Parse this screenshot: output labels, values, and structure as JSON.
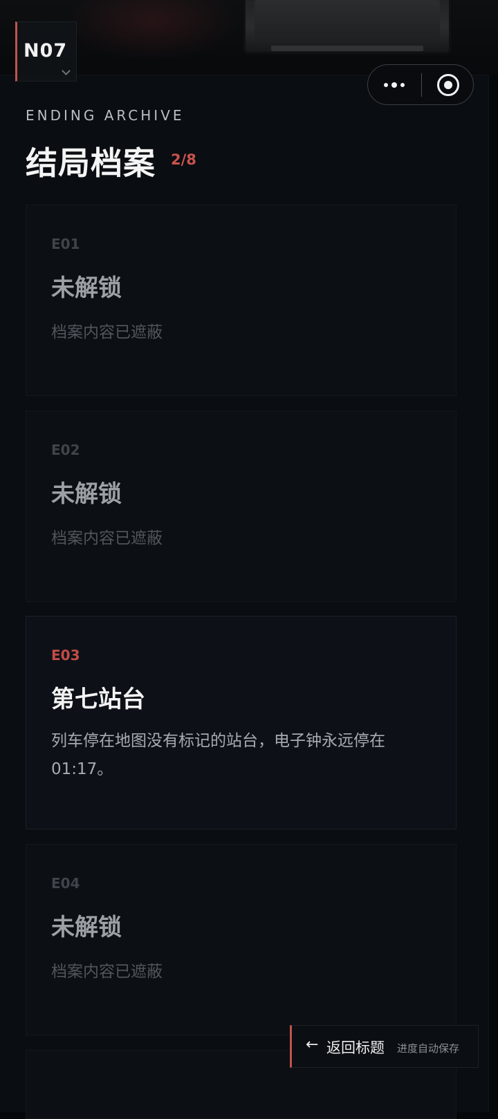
{
  "top_badge": {
    "label": "N07"
  },
  "capsule": {
    "more_icon": "more-dots-icon",
    "target_icon": "close-target-icon"
  },
  "header": {
    "subtitle": "ENDING ARCHIVE",
    "title": "结局档案",
    "count": "2/8"
  },
  "endings": [
    {
      "code": "E01",
      "name": "未解锁",
      "desc": "档案内容已遮蔽",
      "unlocked": false
    },
    {
      "code": "E02",
      "name": "未解锁",
      "desc": "档案内容已遮蔽",
      "unlocked": false
    },
    {
      "code": "E03",
      "name": "第七站台",
      "desc": "列车停在地图没有标记的站台，电子钟永远停在01:17。",
      "unlocked": true
    },
    {
      "code": "E04",
      "name": "未解锁",
      "desc": "档案内容已遮蔽",
      "unlocked": false
    }
  ],
  "footer": {
    "back_arrow": "←",
    "back_label": "返回标题",
    "autosave_hint": "进度自动保存"
  },
  "colors": {
    "accent": "#c0544e",
    "background": "#0a0d11"
  }
}
